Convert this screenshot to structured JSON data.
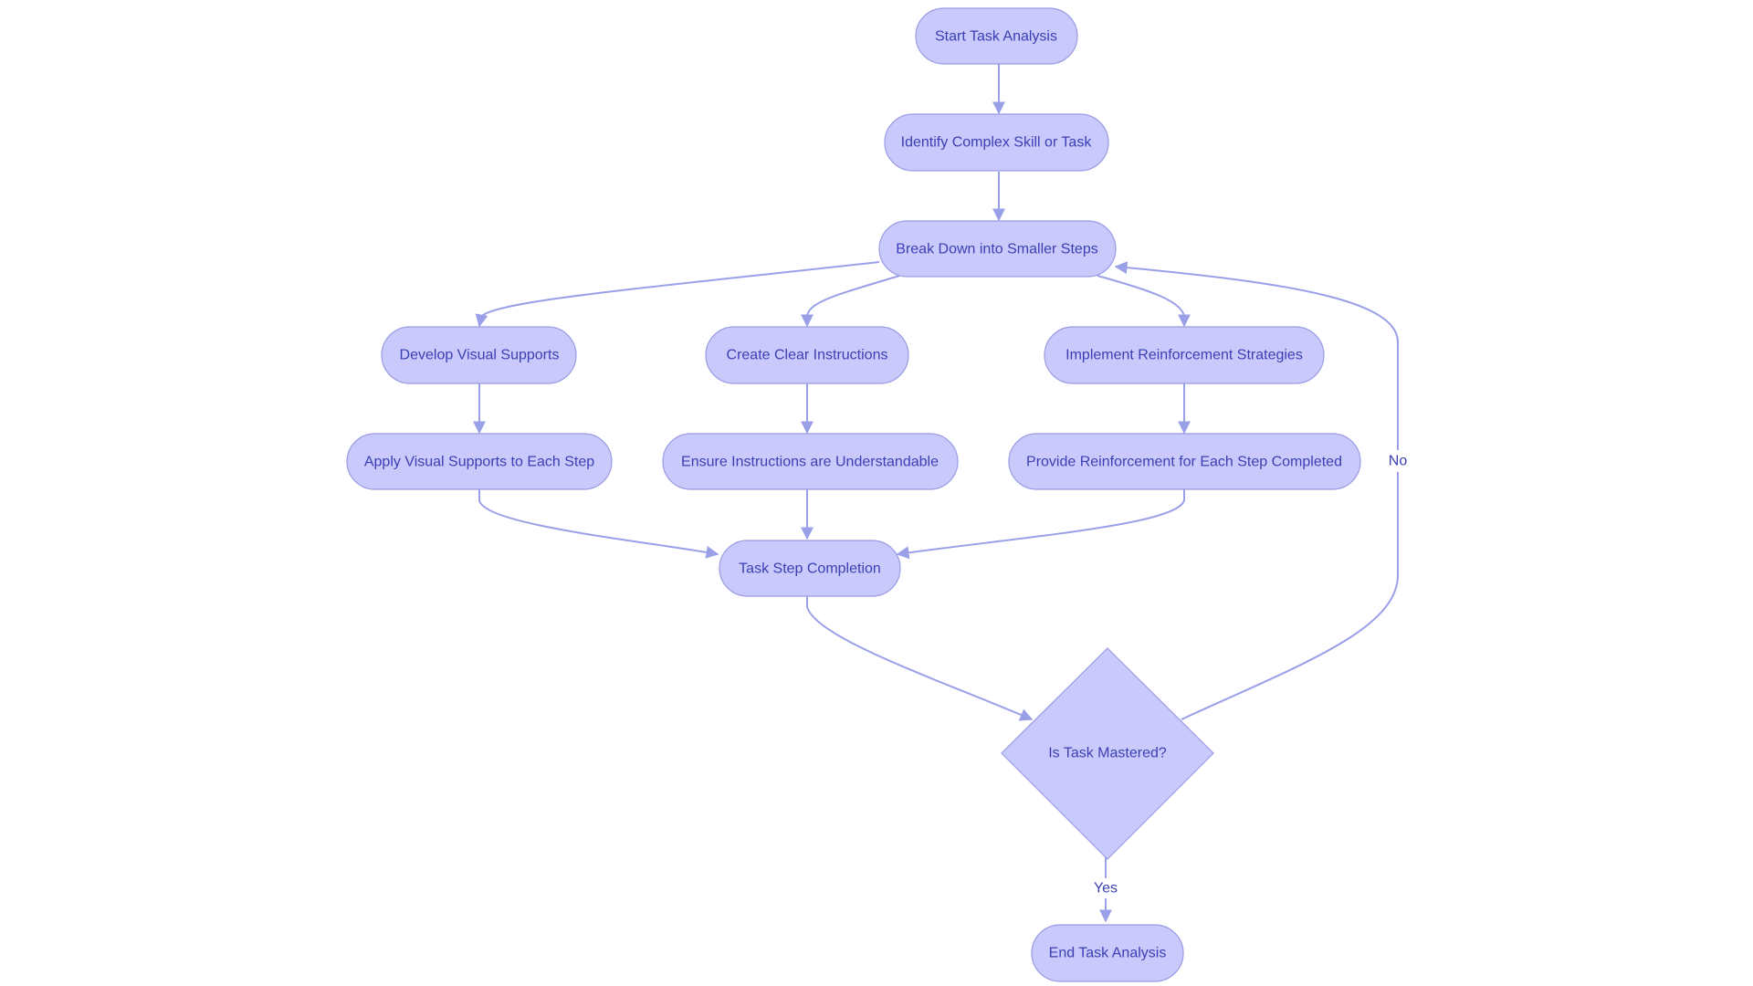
{
  "diagram": {
    "type": "flowchart",
    "colors": {
      "node_fill": "#c9c9fc",
      "node_stroke": "#9a9ce4",
      "text": "#3b3fb3",
      "edge": "#9aa0e8"
    },
    "nodes": [
      {
        "id": "start",
        "label": "Start Task Analysis",
        "shape": "stadium"
      },
      {
        "id": "identify",
        "label": "Identify Complex Skill or Task",
        "shape": "stadium"
      },
      {
        "id": "breakdown",
        "label": "Break Down into Smaller Steps",
        "shape": "stadium"
      },
      {
        "id": "visual",
        "label": "Develop Visual Supports",
        "shape": "stadium"
      },
      {
        "id": "instructions",
        "label": "Create Clear Instructions",
        "shape": "stadium"
      },
      {
        "id": "reinforce",
        "label": "Implement Reinforcement Strategies",
        "shape": "stadium"
      },
      {
        "id": "applyvisual",
        "label": "Apply Visual Supports to Each Step",
        "shape": "stadium"
      },
      {
        "id": "ensure",
        "label": "Ensure Instructions are Understandable",
        "shape": "stadium"
      },
      {
        "id": "provide",
        "label": "Provide Reinforcement for Each Step Completed",
        "shape": "stadium"
      },
      {
        "id": "completion",
        "label": "Task Step Completion",
        "shape": "stadium"
      },
      {
        "id": "mastered",
        "label": "Is Task Mastered?",
        "shape": "diamond"
      },
      {
        "id": "end",
        "label": "End Task Analysis",
        "shape": "stadium"
      }
    ],
    "edges": [
      {
        "from": "start",
        "to": "identify",
        "label": ""
      },
      {
        "from": "identify",
        "to": "breakdown",
        "label": ""
      },
      {
        "from": "breakdown",
        "to": "visual",
        "label": ""
      },
      {
        "from": "breakdown",
        "to": "instructions",
        "label": ""
      },
      {
        "from": "breakdown",
        "to": "reinforce",
        "label": ""
      },
      {
        "from": "visual",
        "to": "applyvisual",
        "label": ""
      },
      {
        "from": "instructions",
        "to": "ensure",
        "label": ""
      },
      {
        "from": "reinforce",
        "to": "provide",
        "label": ""
      },
      {
        "from": "applyvisual",
        "to": "completion",
        "label": ""
      },
      {
        "from": "ensure",
        "to": "completion",
        "label": ""
      },
      {
        "from": "provide",
        "to": "completion",
        "label": ""
      },
      {
        "from": "completion",
        "to": "mastered",
        "label": ""
      },
      {
        "from": "mastered",
        "to": "breakdown",
        "label": "No"
      },
      {
        "from": "mastered",
        "to": "end",
        "label": "Yes"
      }
    ]
  }
}
